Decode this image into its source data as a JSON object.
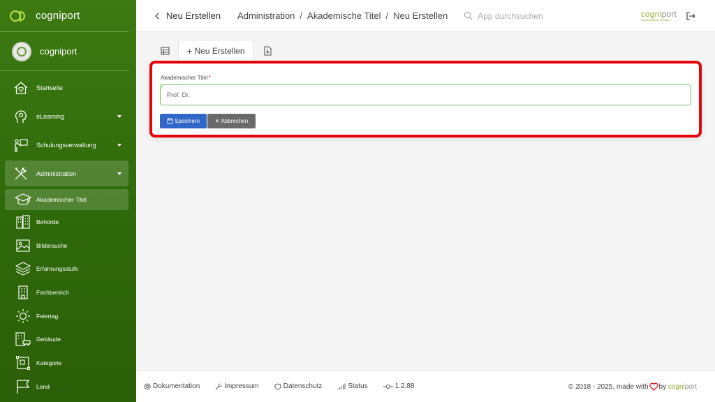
{
  "app": {
    "name": "cogniport"
  },
  "user": {
    "name": "cogniport"
  },
  "sidebar": {
    "items": [
      {
        "label": "Startseite",
        "icon": "home-heart-icon",
        "has_caret": false
      },
      {
        "label": "eLearning",
        "icon": "head-gear-icon",
        "has_caret": true
      },
      {
        "label": "Schulungsverwaltung",
        "icon": "presenter-icon",
        "has_caret": true
      },
      {
        "label": "Administration",
        "icon": "tools-icon",
        "has_caret": true,
        "active": true
      }
    ],
    "sub_items": [
      {
        "label": "Akademischer Titel",
        "icon": "graduation-cap-icon",
        "active": true
      },
      {
        "label": "Behörde",
        "icon": "buildings-icon"
      },
      {
        "label": "Bildersuche",
        "icon": "image-icon"
      },
      {
        "label": "Erfahrungsstufe",
        "icon": "layers-icon"
      },
      {
        "label": "Fachbereich",
        "icon": "building-icon"
      },
      {
        "label": "Feiertag",
        "icon": "sun-icon"
      },
      {
        "label": "Gebäude",
        "icon": "building-car-icon"
      },
      {
        "label": "Kategorie",
        "icon": "category-icon"
      },
      {
        "label": "Land",
        "icon": "flag-icon"
      }
    ]
  },
  "header": {
    "back_label": "Neu Erstellen",
    "breadcrumb": [
      "Administration",
      "Akademische Titel",
      "Neu Erstellen"
    ],
    "search_placeholder": "App durchsuchen",
    "logo_part1": "cogni",
    "logo_part2": "port",
    "logo_tagline": "Flexibles Wissen verwalten"
  },
  "tabs": {
    "new_label": "Neu Erstellen"
  },
  "form": {
    "field_label": "Akademischer Titel",
    "required_mark": "*",
    "value": "Prof. Dr.",
    "save_label": "Speichern",
    "cancel_label": "Abbrechen"
  },
  "footer": {
    "links": [
      "Dokumentation",
      "Impressum",
      "Datenschutz",
      "Status"
    ],
    "version": "1.2.88",
    "copyright": "© 2018 - 2025, made with",
    "by": "by",
    "brand_part1": "cogni",
    "brand_part2": "port"
  },
  "colors": {
    "sidebar": "#2f6a0a",
    "accent": "#8cb02a",
    "highlight_border": "#e8000a",
    "save": "#2f66c7",
    "cancel": "#6a6a6a",
    "heart": "#e0101a"
  }
}
